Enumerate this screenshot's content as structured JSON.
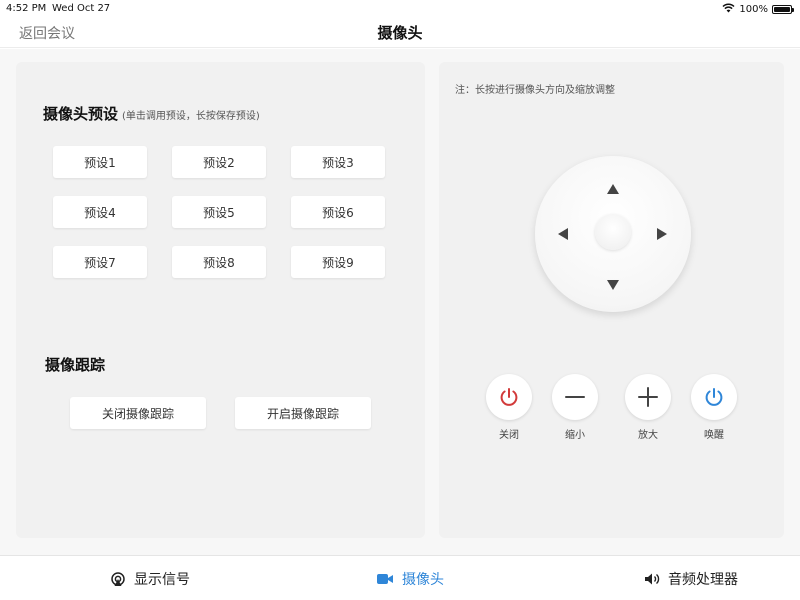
{
  "status_bar": {
    "time": "4:52 PM",
    "date": "Wed Oct 27",
    "battery": "100%"
  },
  "nav": {
    "back_label": "返回会议",
    "title": "摄像头"
  },
  "presets": {
    "title": "摄像头预设",
    "hint": "(单击调用预设，长按保存预设)",
    "items": [
      "预设1",
      "预设2",
      "预设3",
      "预设4",
      "预设5",
      "预设6",
      "预设7",
      "预设8",
      "预设9"
    ]
  },
  "tracking": {
    "title": "摄像跟踪",
    "off_label": "关闭摄像跟踪",
    "on_label": "开启摄像跟踪"
  },
  "control": {
    "note": "注：长按进行摄像头方向及缩放调整",
    "buttons": [
      {
        "label": "关闭",
        "icon": "power-icon",
        "color": "#d23a3a"
      },
      {
        "label": "缩小",
        "icon": "minus-icon",
        "color": "#444444"
      },
      {
        "label": "放大",
        "icon": "plus-icon",
        "color": "#444444"
      },
      {
        "label": "唤醒",
        "icon": "power-icon",
        "color": "#2f86d8"
      }
    ]
  },
  "tabs": [
    {
      "label": "显示信号",
      "icon": "signal-icon",
      "active": false
    },
    {
      "label": "摄像头",
      "icon": "video-camera-icon",
      "active": true
    },
    {
      "label": "音频处理器",
      "icon": "speaker-icon",
      "active": false
    }
  ],
  "colors": {
    "accent": "#2f86d8",
    "power_off": "#d23a3a"
  }
}
